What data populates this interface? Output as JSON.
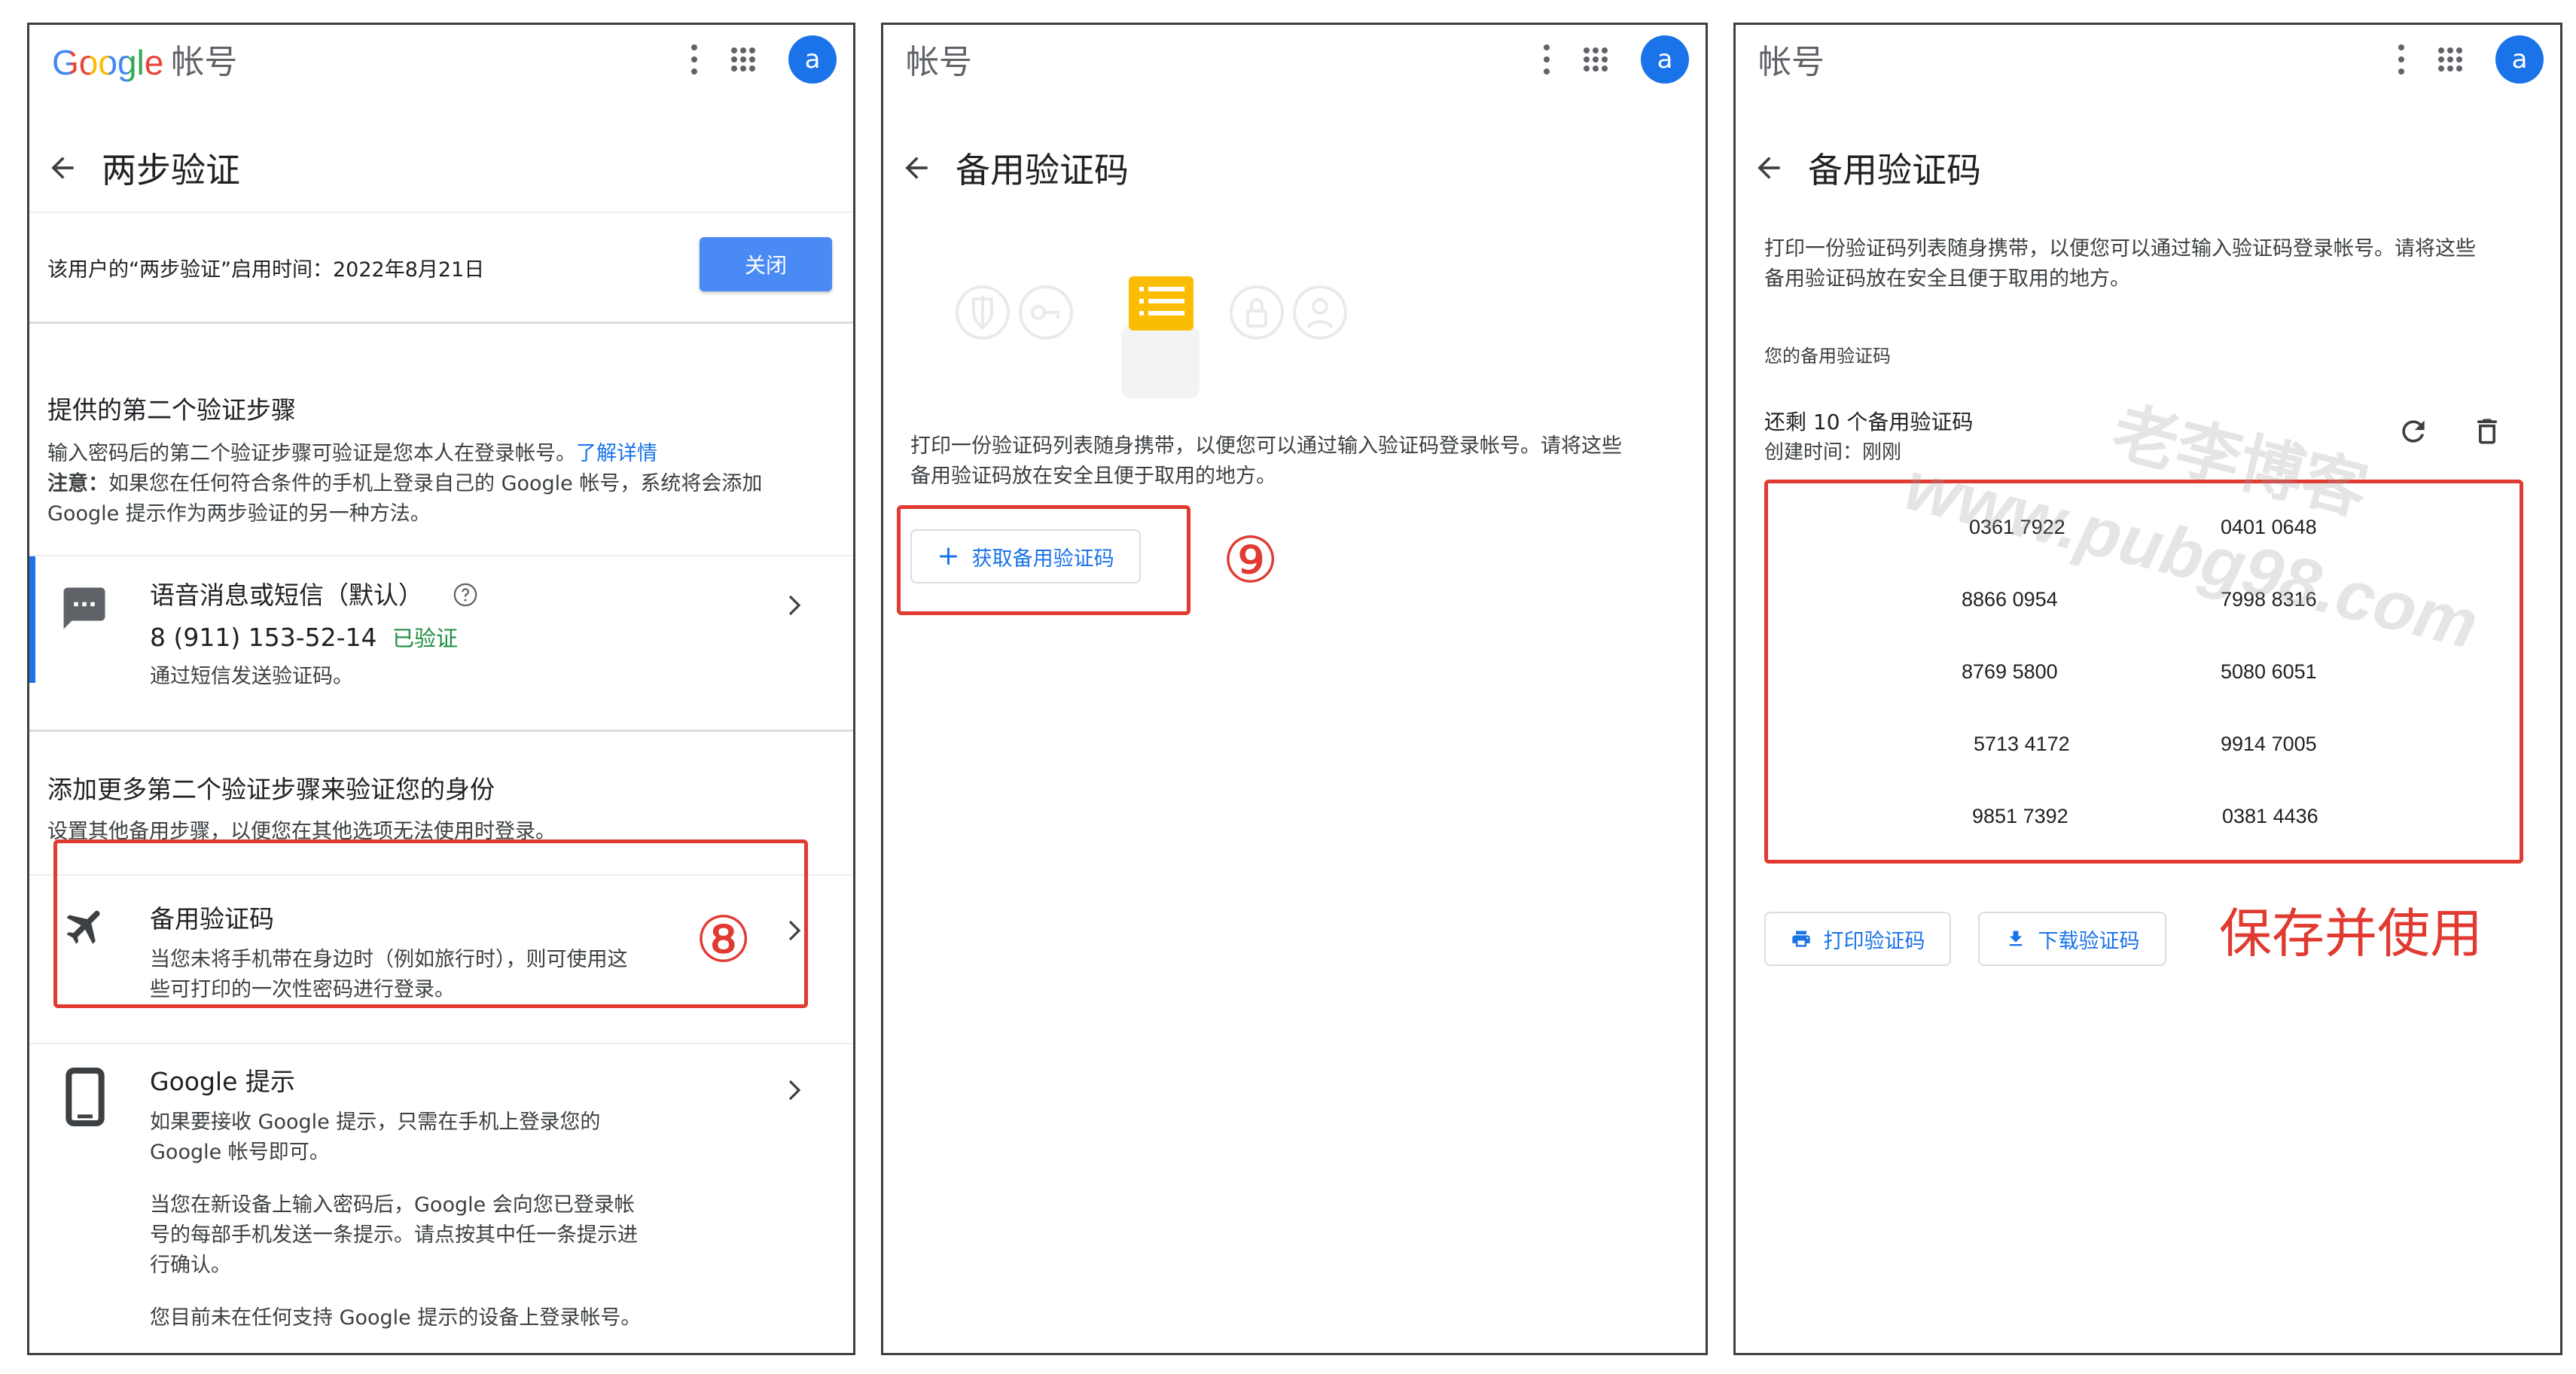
{
  "panel1": {
    "brand_logo": "Google",
    "brand_account": "帐号",
    "avatar": "a",
    "title": "两步验证",
    "enabled_text": "该用户的“两步验证”启用时间：2022年8月21日",
    "close_button": "关闭",
    "second_step_heading": "提供的第二个验证步骤",
    "second_step_desc": "输入密码后的第二个验证步骤可验证是您本人在登录帐号。",
    "learn_more": "了解详情",
    "note_label": "注意：",
    "note_text_1": "如果您在任何符合条件的手机上登录自己的 Google 帐号，系统将会添加",
    "note_text_2": "Google 提示作为两步验证的另一种方法。",
    "sms_title": "语音消息或短信（默认）",
    "sms_phone": "8 (911) 153-52-14",
    "sms_verified": "已验证",
    "sms_desc": "通过短信发送验证码。",
    "add_more_heading": "添加更多第二个验证步骤来验证您的身份",
    "add_more_desc": "设置其他备用步骤，以便您在其他选项无法使用时登录。",
    "backup_title": "备用验证码",
    "backup_desc_1": "当您未将手机带在身边时（例如旅行时），则可使用这",
    "backup_desc_2": "些可打印的一次性密码进行登录。",
    "step_marker": "⑧",
    "prompt_title": "Google 提示",
    "prompt_desc_1": "如果要接收 Google 提示，只需在手机上登录您的",
    "prompt_desc_2": "Google 帐号即可。",
    "prompt_desc_3": "当您在新设备上输入密码后，Google 会向您已登录帐",
    "prompt_desc_4": "号的每部手机发送一条提示。请点按其中任一条提示进",
    "prompt_desc_5": "行确认。",
    "prompt_desc_6": "您目前未在任何支持 Google 提示的设备上登录帐号。"
  },
  "panel2": {
    "brand_account": "帐号",
    "avatar": "a",
    "title": "备用验证码",
    "desc_1": "打印一份验证码列表随身携带，以便您可以通过输入验证码登录帐号。请将这些",
    "desc_2": "备用验证码放在安全且便于取用的地方。",
    "get_codes_button": "获取备用验证码",
    "step_marker": "⑨"
  },
  "panel3": {
    "brand_account": "帐号",
    "avatar": "a",
    "title": "备用验证码",
    "desc_1": "打印一份验证码列表随身携带，以便您可以通过输入验证码登录帐号。请将这些",
    "desc_2": "备用验证码放在安全且便于取用的地方。",
    "codes_label": "您的备用验证码",
    "remaining": "还剩 10 个备用验证码",
    "created": "创建时间：刚刚",
    "codes": [
      "0361 7922",
      "0401 0648",
      "8866 0954",
      "7998 8316",
      "8769 5800",
      "5080 6051",
      "5713 4172",
      "9914 7005",
      "9851 7392",
      "0381 4436"
    ],
    "print_button": "打印验证码",
    "download_button": "下载验证码",
    "annotation": "保存并使用",
    "watermark_1": "老李博客",
    "watermark_2": "www.pubg98.com"
  },
  "colors": {
    "accent_blue": "#1a73e8",
    "button_blue": "#4a8af4",
    "annotation_red": "#e03a31",
    "verified_green": "#1e8e3e"
  }
}
